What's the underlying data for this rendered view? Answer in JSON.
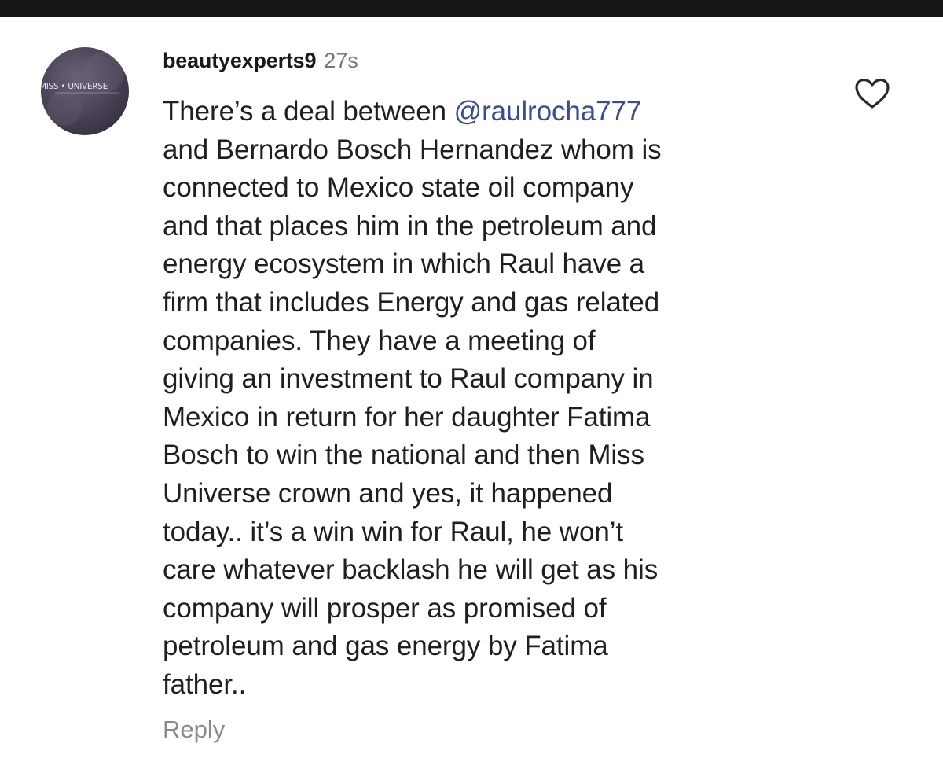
{
  "avatar": {
    "text": "MISS • UNIVERSE",
    "background": "#4a4256"
  },
  "comment": {
    "username": "beautyexperts9",
    "timestamp": "27s",
    "mention": "@raulrocha777",
    "first_line_prefix": "There’s a deal between ",
    "lines": [
      "and Bernardo Bosch Hernandez whom is",
      "connected to Mexico state oil company",
      "and that places him in the petroleum and",
      "energy ecosystem in which Raul have a",
      "firm that includes Energy and gas related",
      "companies. They have a meeting of",
      "giving an investment to Raul company in",
      "Mexico in return for her daughter Fatima",
      "Bosch to win the national and then Miss",
      "Universe crown and yes, it happened",
      "today.. it’s a win win for Raul, he won’t",
      "care whatever backlash he will get as his",
      "company will prosper as promised of",
      "petroleum and gas energy by Fatima",
      "father.."
    ],
    "reply_label": "Reply",
    "like_icon": "heart-outline-icon"
  },
  "colors": {
    "mention": "#3a4b8f",
    "text": "#1f1f1f",
    "muted": "#8a8a8a",
    "top_bar": "#161616"
  }
}
